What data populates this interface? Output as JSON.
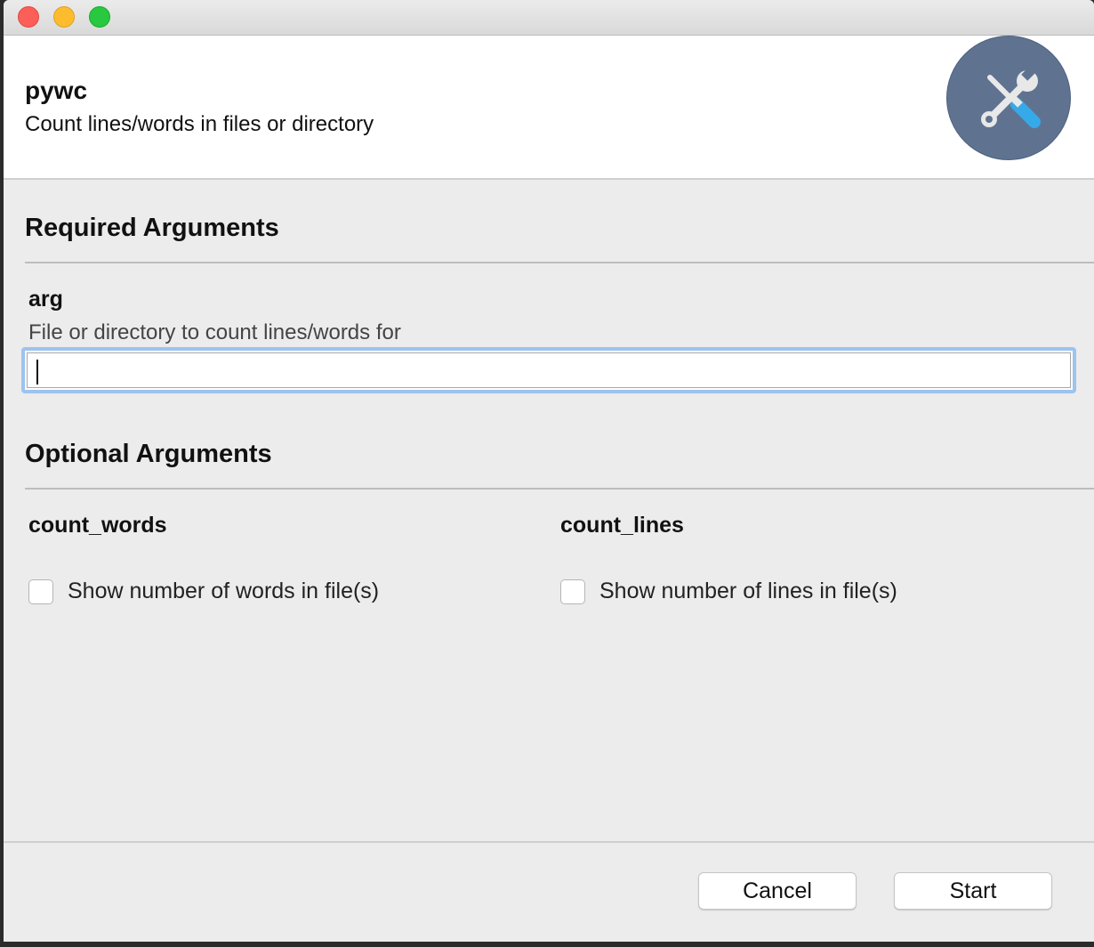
{
  "window": {
    "controls": [
      "close",
      "minimize",
      "zoom"
    ]
  },
  "header": {
    "title": "pywc",
    "description": "Count lines/words in files or directory",
    "icon": "tools-icon",
    "icon_bg": "#5f7391"
  },
  "required": {
    "heading": "Required Arguments",
    "args": [
      {
        "name": "arg",
        "help": "File or directory to count lines/words for",
        "value": "",
        "placeholder": ""
      }
    ]
  },
  "optional": {
    "heading": "Optional Arguments",
    "args": [
      {
        "name": "count_words",
        "checkbox_label": "Show number of words in file(s)",
        "checked": false
      },
      {
        "name": "count_lines",
        "checkbox_label": "Show number of lines in file(s)",
        "checked": false
      }
    ]
  },
  "footer": {
    "cancel_label": "Cancel",
    "start_label": "Start"
  },
  "colors": {
    "focus_ring": "#9dc3ef",
    "close": "#fc5f57",
    "minimize": "#fdbc2e",
    "zoom": "#28c840"
  }
}
